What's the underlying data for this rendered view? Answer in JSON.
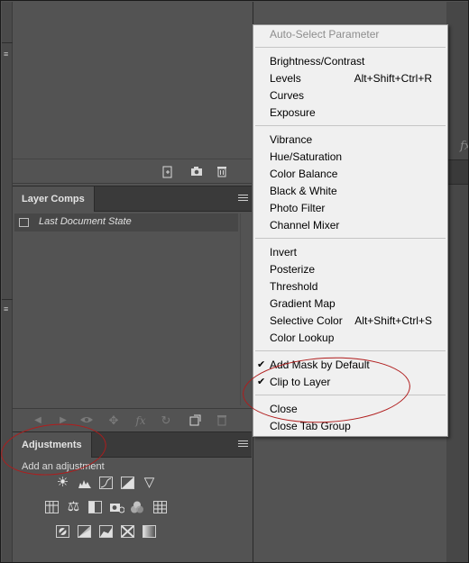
{
  "layer_comps_panel": {
    "tab_label": "Layer Comps",
    "items": [
      {
        "label": "Last Document State"
      }
    ]
  },
  "adjustments_panel": {
    "tab_label": "Adjustments",
    "hint": "Add an adjustment"
  },
  "context_menu": {
    "items": [
      {
        "label": "Auto-Select Parameter",
        "disabled": true
      },
      {
        "label": "Brightness/Contrast"
      },
      {
        "label": "Levels",
        "shortcut": "Alt+Shift+Ctrl+R"
      },
      {
        "label": "Curves"
      },
      {
        "label": "Exposure"
      },
      {
        "label": "Vibrance"
      },
      {
        "label": "Hue/Saturation"
      },
      {
        "label": "Color Balance"
      },
      {
        "label": "Black & White"
      },
      {
        "label": "Photo Filter"
      },
      {
        "label": "Channel Mixer"
      },
      {
        "label": "Invert"
      },
      {
        "label": "Posterize"
      },
      {
        "label": "Threshold"
      },
      {
        "label": "Gradient Map"
      },
      {
        "label": "Selective Color",
        "shortcut": "Alt+Shift+Ctrl+S"
      },
      {
        "label": "Color Lookup"
      },
      {
        "label": "Add Mask by Default",
        "checked": true
      },
      {
        "label": "Clip to Layer",
        "checked": true
      },
      {
        "label": "Close"
      },
      {
        "label": "Close Tab Group"
      }
    ]
  },
  "colors": {
    "panel_bg": "#535353",
    "menu_bg": "#f0f0f0",
    "annotation_red": "#b01c1c"
  },
  "icons": {
    "right_panel_glyph": "fx"
  }
}
